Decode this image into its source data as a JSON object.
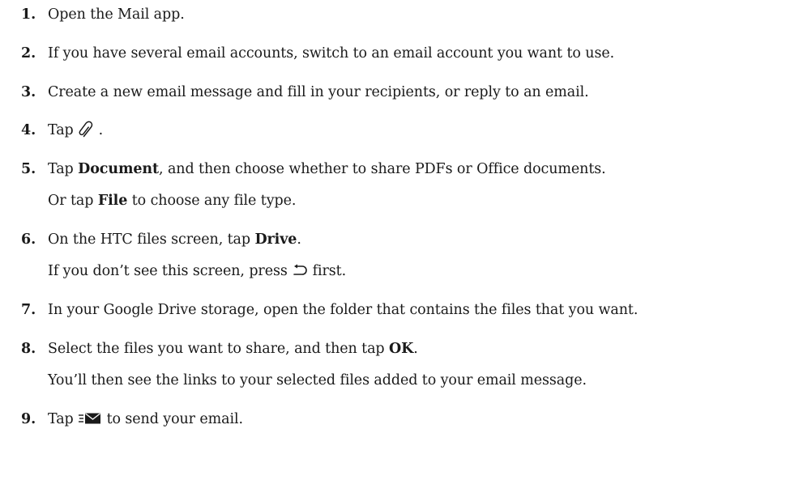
{
  "steps": [
    {
      "num": "1.",
      "text": "Open the Mail app."
    },
    {
      "num": "2.",
      "text": "If you have several email accounts, switch to an email account you want to use."
    },
    {
      "num": "3.",
      "text": "Create a new email message and fill in your recipients, or reply to an email."
    },
    {
      "num": "4.",
      "pre": "Tap ",
      "icon": "paperclip-icon",
      "post": " ."
    },
    {
      "num": "5.",
      "pre": "Tap ",
      "bold": "Document",
      "post": ", and then choose whether to share PDFs or Office documents.",
      "note": {
        "pre": "Or tap ",
        "bold": "File",
        "post": " to choose any file type."
      }
    },
    {
      "num": "6.",
      "pre": "On the HTC files screen, tap ",
      "bold": "Drive",
      "post": ".",
      "note": {
        "pre": "If you don’t see this screen, press ",
        "icon": "back-arrow-icon",
        "post": " first."
      }
    },
    {
      "num": "7.",
      "text": "In your Google Drive storage, open the folder that contains the files that you want."
    },
    {
      "num": "8.",
      "pre": "Select the files you want to share, and then tap ",
      "bold": "OK",
      "post": ".",
      "note": {
        "text": "You’ll then see the links to your selected files added to your email message."
      }
    },
    {
      "num": "9.",
      "pre": "Tap ",
      "icon": "send-mail-icon",
      "post": " to send your email."
    }
  ]
}
